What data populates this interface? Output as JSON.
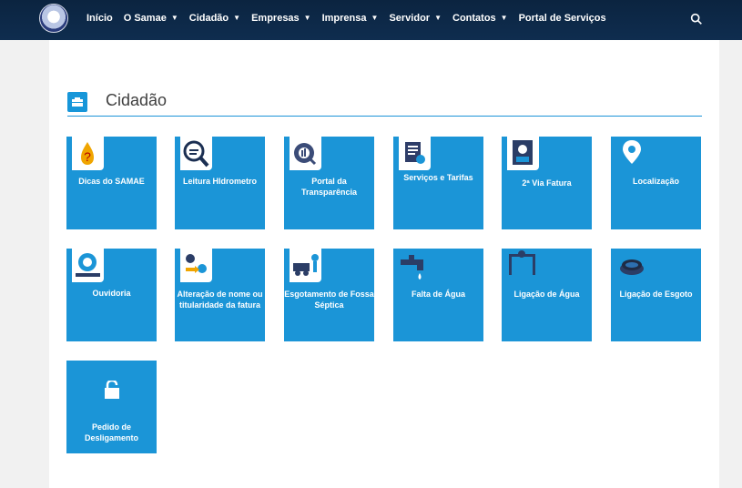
{
  "header": {
    "logo": "samae-logo",
    "nav": [
      "Início",
      "O Samae",
      "Cidadão",
      "Empresas",
      "Imprensa",
      "Servidor",
      "Contatos",
      "Portal de Serviços"
    ],
    "search_icon": "search-icon"
  },
  "section": {
    "title": "Cidadão",
    "icon": "briefcase-icon",
    "accent_color": "#1b95d7"
  },
  "tiles": [
    {
      "label": "Dicas do SAMAE",
      "icon": "question-drop-icon"
    },
    {
      "label": "Leitura HIdrometro",
      "icon": "meter-reading-icon"
    },
    {
      "label": "Portal da Transparência",
      "icon": "transparency-icon"
    },
    {
      "label": "Serviços e Tarifas",
      "icon": "tariffs-icon"
    },
    {
      "label": "2ª Via Fatura",
      "icon": "invoice-copy-icon"
    },
    {
      "label": "Localização",
      "icon": "location-pin-icon"
    },
    {
      "label": "Ouvidoria",
      "icon": "ombudsman-icon"
    },
    {
      "label": "Alteração de nome ou titularidade da fatura",
      "icon": "name-change-icon"
    },
    {
      "label": "Esgotamento de Fossa Séptica",
      "icon": "septic-tank-icon"
    },
    {
      "label": "Falta de Água",
      "icon": "water-tap-icon"
    },
    {
      "label": "Ligação de Água",
      "icon": "water-connection-icon"
    },
    {
      "label": "Ligação de Esgoto",
      "icon": "sewer-connection-icon"
    },
    {
      "label": "Pedido de Desligamento",
      "icon": "unlock-icon"
    }
  ]
}
